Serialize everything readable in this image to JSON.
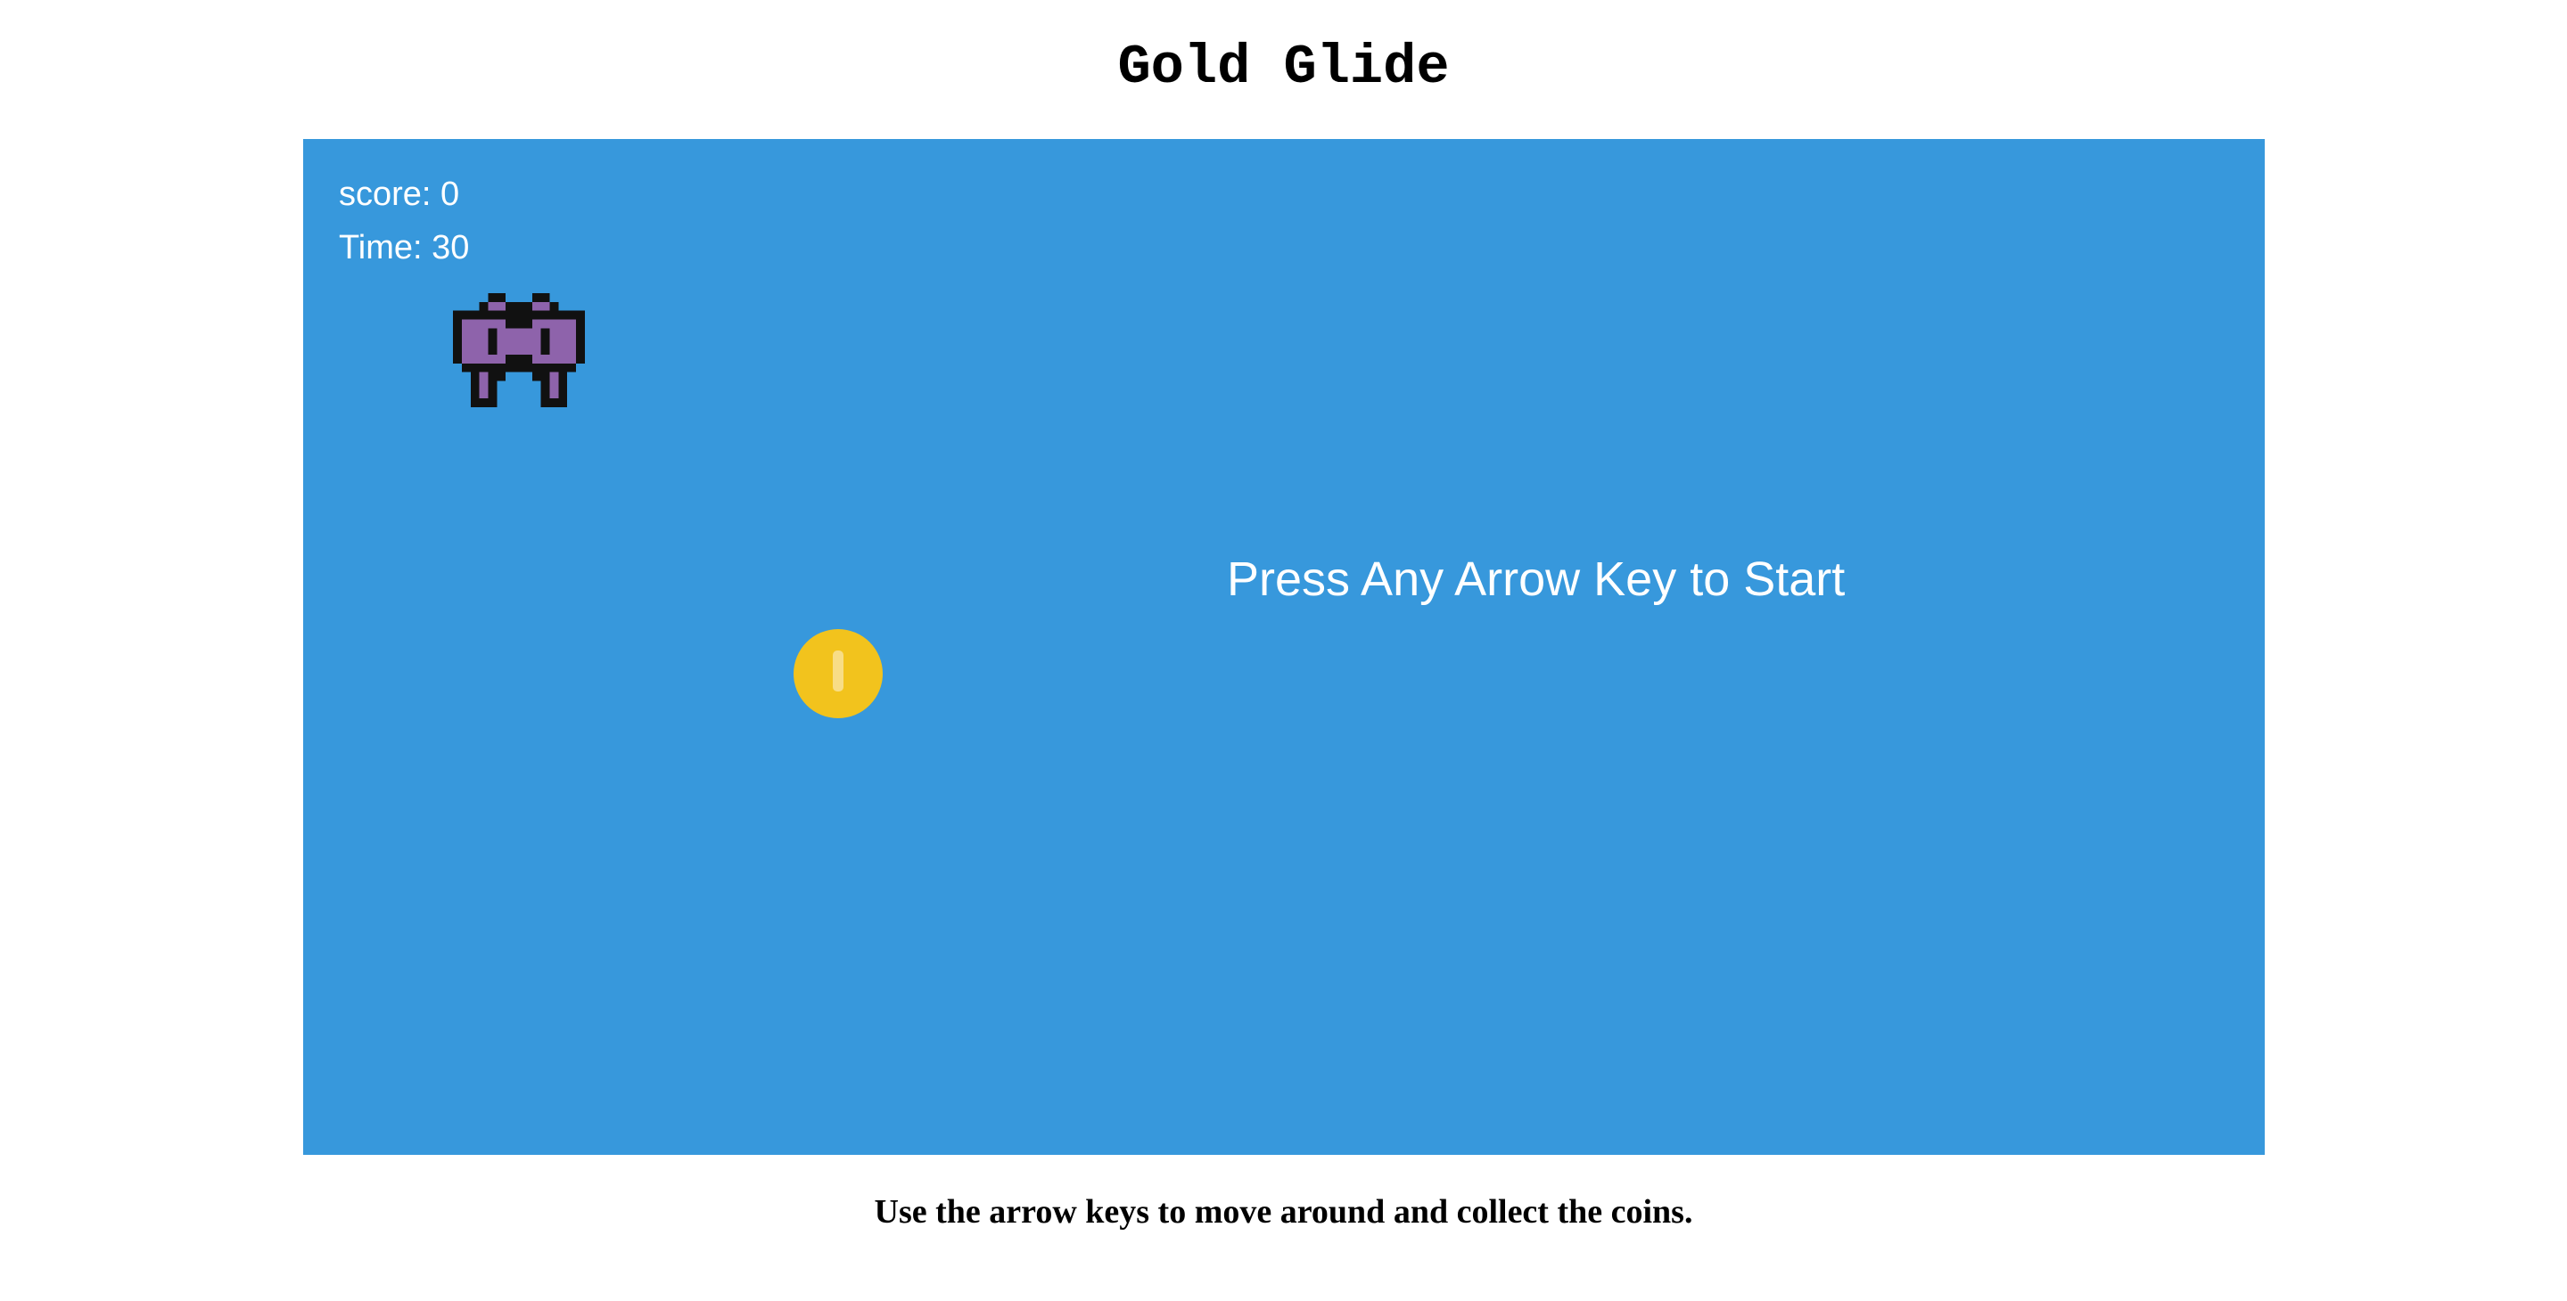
{
  "title": "Gold Glide",
  "hud": {
    "score_text": "score: 0",
    "time_text": "Time: 30"
  },
  "start_message": "Press Any Arrow Key to Start",
  "instructions": "Use the arrow keys to move around and collect the coins.",
  "sprites": {
    "player_icon": "purple-space-invader-icon",
    "coin_icon": "gold-coin-icon"
  },
  "colors": {
    "game_background": "#3798dc",
    "player_body": "#8e63ab",
    "coin": "#f2c31d",
    "coin_highlight": "#f8dd86",
    "text_on_game": "#ffffff",
    "page_text": "#000000"
  }
}
